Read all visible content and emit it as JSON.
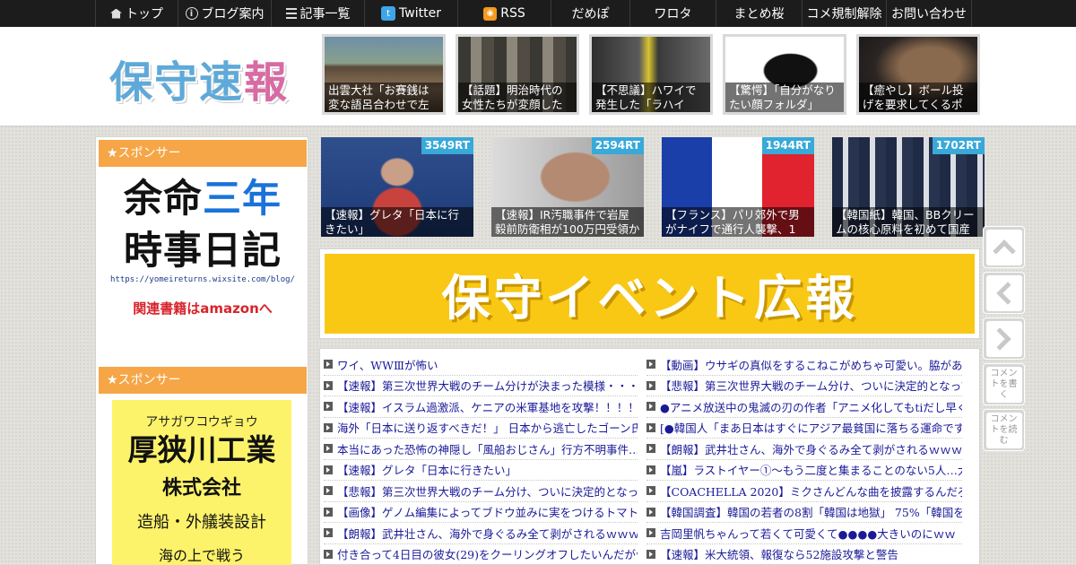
{
  "nav": {
    "items": [
      {
        "label": "トップ",
        "icon": "home-icon"
      },
      {
        "label": "ブログ案内",
        "icon": "info-icon"
      },
      {
        "label": "記事一覧",
        "icon": "list-icon"
      },
      {
        "label": "Twitter",
        "icon": "twitter-icon"
      },
      {
        "label": "RSS",
        "icon": "rss-icon"
      },
      {
        "label": "だめぽ",
        "icon": ""
      },
      {
        "label": "ワロタ",
        "icon": ""
      },
      {
        "label": "まとめ桜",
        "icon": ""
      },
      {
        "label": "コメ規制解除",
        "icon": ""
      },
      {
        "label": "お問い合わせ",
        "icon": ""
      }
    ]
  },
  "header": {
    "logo_a": "保守",
    "logo_b": "速",
    "logo_c": "報",
    "thumbs": [
      {
        "caption": "出雲大社「お賽銭は変な語呂合わせで左"
      },
      {
        "caption": "【話題】明治時代の女性たちが変顔した"
      },
      {
        "caption": "【不思議】ハワイで発生した「ラハイ"
      },
      {
        "caption": "【驚愕】「自分がなりたい顔フォルダ」"
      },
      {
        "caption": "【癒やし】ボール投げを要求してくるポ"
      }
    ]
  },
  "sidebar": {
    "sponsor_label": "★スポンサー",
    "ad1": {
      "line1a": "余命",
      "line1b": "三年",
      "line2": "時事日記",
      "url": "https://yomeireturns.wixsite.com/blog/",
      "link": "関連書籍はamazonへ"
    },
    "ad2": {
      "kana": "アサガワコウギョウ",
      "name": "厚狭川工業",
      "corp": "株式会社",
      "work": "造船・外艤装設計",
      "more": "海の上で戦う"
    }
  },
  "rt_thumbs": [
    {
      "rt": "3549RT",
      "caption": "【速報】グレタ「日本に行きたい」"
    },
    {
      "rt": "2594RT",
      "caption": "【速報】IR汚職事件で岩屋毅前防衛相が100万円受領か"
    },
    {
      "rt": "1944RT",
      "caption": "【フランス】パリ郊外で男がナイフで通行人襲撃、1"
    },
    {
      "rt": "1702RT",
      "caption": "【韓国紙】韓国、BBクリームの核心原料を初めて国産"
    }
  ],
  "banner": {
    "text": "保守イベント広報"
  },
  "list_left": [
    "ワイ、WWⅢが怖い",
    "【速報】第三次世界大戦のチーム分けが決まった模様・・・・",
    "【速報】イスラム過激派、ケニアの米軍基地を攻撃！！！！！",
    "海外「日本に送り返すべきだ！」 日本から逃亡したゴーン氏に",
    "本当にあった恐怖の神隠し「風船おじさん」行方不明事件…海",
    "【速報】グレタ「日本に行きたい」",
    "【悲報】第三次世界大戦のチーム分け、ついに決定的となって",
    "【画像】ゲノム編集によってブドウ並みに実をつけるトマトが",
    "【朗報】武井壮さん、海外で身ぐるみ全て剥がされるｗｗｗｗ",
    "付き合って4日目の彼女(29)をクーリングオフしたいんだがｗｗ"
  ],
  "list_right": [
    "【動画】ウサギの真似をするこねこがめちゃ可愛い。脇があま",
    "【悲報】第三次世界大戦のチーム分け、ついに決定的となって",
    "●アニメ放送中の鬼滅の刃の作者「アニメ化してもtiだし早く",
    "[●韓国人「まあ日本はすぐにアジア最貧国に落ちる運命です」",
    "【朗報】武井壮さん、海外で身ぐるみ全て剥がされるｗｗｗｗ",
    "【嵐】ラストイヤー①～もう二度と集まることのない5人…大",
    "【COACHELLA 2020】ミクさんどんな曲を披露するんだろうね",
    "【韓国調査】韓国の若者の8割「韓国は地獄」 75%「韓国を",
    "吉岡里帆ちゃんって若くて可愛くて●●●●大きいのにｗｗ",
    "【速報】米大統領、報復なら52施設攻撃と警告"
  ],
  "side_buttons": {
    "write": "コメントを書く",
    "read": "コメントを読む"
  }
}
